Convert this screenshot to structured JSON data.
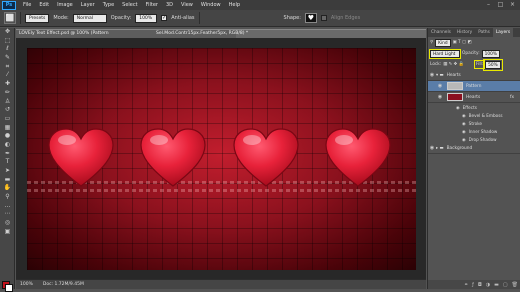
{
  "app": {
    "logo": "Ps"
  },
  "menu": [
    "File",
    "Edit",
    "Image",
    "Layer",
    "Type",
    "Select",
    "Filter",
    "3D",
    "View",
    "Window",
    "Help"
  ],
  "window_controls": [
    "–",
    "□",
    "×"
  ],
  "options": {
    "preset_label": "Presets",
    "mode_label": "Mode:",
    "mode_value": "Normal",
    "opacity_label": "Opacity:",
    "opacity_value": "100%",
    "antialias_label": "Anti-alias",
    "shape_label": "Shape:",
    "align_edges_label": "Align Edges"
  },
  "document": {
    "tab_title": "LOVEly Text Effect.psd @ 100% (Pattern",
    "tab_title_2": "Sel.Mod.Contr15px.Feather5px, RGB/8) *"
  },
  "status": {
    "zoom": "100%",
    "doc_info": "Doc: 1.72M/9.45M"
  },
  "panel": {
    "tabs": [
      "Channels",
      "History",
      "Paths",
      "Layers"
    ],
    "active_tab": "Layers",
    "filter_label": "Kind",
    "blend_mode": "Hard Light",
    "opacity_label": "Opacity:",
    "opacity_value": "100%",
    "lock_label": "Lock:",
    "fill_label": "Fill:",
    "fill_value": "50%",
    "layers": [
      {
        "name": "Hearts",
        "type": "group"
      },
      {
        "name": "Pattern",
        "type": "layer"
      },
      {
        "name": "Hearts",
        "type": "layer"
      },
      {
        "name": "Effects",
        "type": "effects"
      },
      {
        "name": "Bevel & Emboss",
        "type": "effect"
      },
      {
        "name": "Stroke",
        "type": "effect"
      },
      {
        "name": "Inner Shadow",
        "type": "effect"
      },
      {
        "name": "Drop Shadow",
        "type": "effect"
      },
      {
        "name": "Background",
        "type": "group"
      }
    ],
    "fx_badge": "fx"
  },
  "colors": {
    "foreground": "#c1121c",
    "background": "#ffffff",
    "heart": "#e8223a"
  }
}
